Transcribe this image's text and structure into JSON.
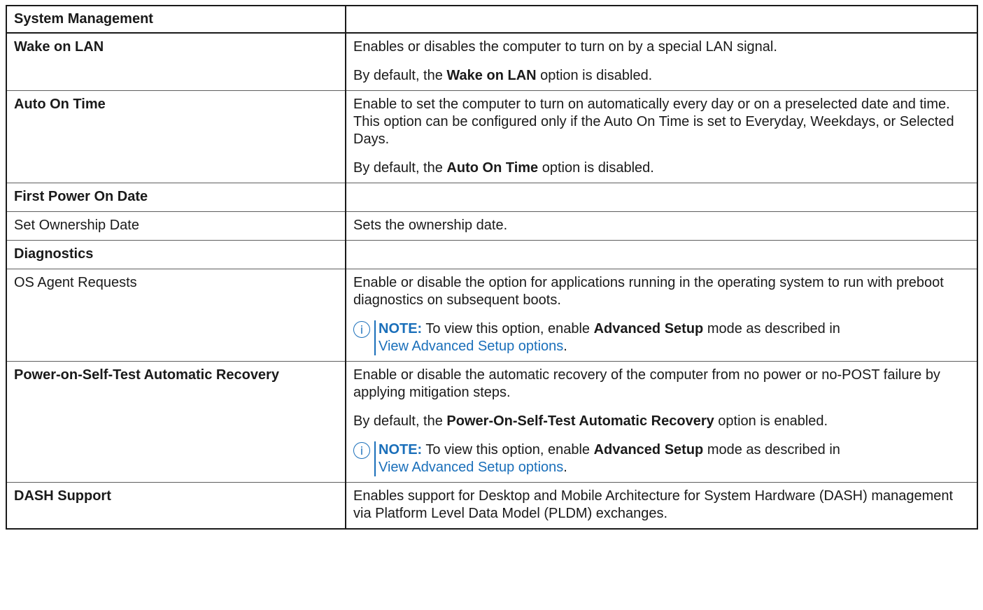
{
  "header": {
    "col1": "System Management",
    "col2": ""
  },
  "rows": {
    "wake": {
      "name": "Wake on LAN",
      "desc": "Enables or disables the computer to turn on by a special LAN signal.",
      "default_pre": "By default, the ",
      "default_bold": "Wake on LAN",
      "default_post": " option is disabled."
    },
    "autoon": {
      "name": "Auto On Time",
      "desc": "Enable to set the computer to turn on automatically every day or on a preselected date and time. This option can be configured only if the Auto On Time is set to Everyday, Weekdays, or Selected Days.",
      "default_pre": "By default, the ",
      "default_bold": "Auto On Time",
      "default_post": " option is disabled."
    },
    "firstpower": {
      "name": "First Power On Date",
      "desc": ""
    },
    "ownership": {
      "name": "Set Ownership Date",
      "desc": "Sets the ownership date."
    },
    "diagnostics": {
      "name": "Diagnostics",
      "desc": ""
    },
    "osagent": {
      "name": "OS Agent Requests",
      "desc": "Enable or disable the option for applications running in the operating system to run with preboot diagnostics on subsequent boots.",
      "note_label": "NOTE:",
      "note_pre": " To view this option, enable ",
      "note_bold": "Advanced Setup",
      "note_post": " mode as described in ",
      "note_link": "View Advanced Setup options",
      "note_end": "."
    },
    "post": {
      "name": "Power-on-Self-Test Automatic Recovery",
      "desc": "Enable or disable the automatic recovery of the computer from no power or no-POST failure by applying mitigation steps.",
      "default_pre": "By default, the ",
      "default_bold": "Power-On-Self-Test Automatic Recovery",
      "default_post": " option is enabled.",
      "note_label": "NOTE:",
      "note_pre": " To view this option, enable ",
      "note_bold": "Advanced Setup",
      "note_post": " mode as described in ",
      "note_link": "View Advanced Setup options",
      "note_end": "."
    },
    "dash": {
      "name": "DASH Support",
      "desc": "Enables support for Desktop and Mobile Architecture for System Hardware (DASH) management via Platform Level Data Model (PLDM) exchanges."
    }
  },
  "icons": {
    "note": "info-icon",
    "note_glyph": "i"
  },
  "colors": {
    "accent": "#1a6fba",
    "text": "#1a1a1a",
    "border": "#1a1a1a"
  }
}
